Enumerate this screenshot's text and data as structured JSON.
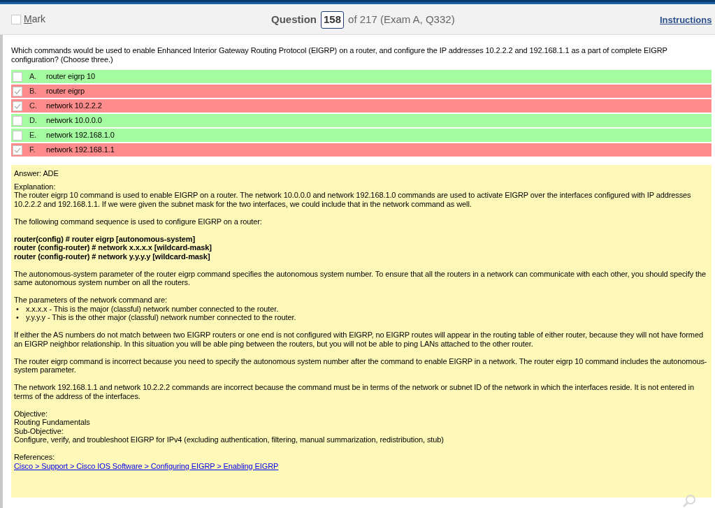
{
  "header": {
    "mark": {
      "label": "Mark",
      "checked": false
    },
    "question_label": "Question",
    "question_number": "158",
    "question_of": "of 217 (Exam A, Q332)",
    "instructions": "Instructions"
  },
  "question": "Which commands would be used to enable Enhanced Interior Gateway Routing Protocol (EIGRP) on a router, and configure the IP addresses 10.2.2.2 and 192.168.1.1 as a part of complete EIGRP configuration? (Choose three.)",
  "options": [
    {
      "letter": "A.",
      "text": "router eigrp 10",
      "checked": false,
      "correct": true
    },
    {
      "letter": "B.",
      "text": "router eigrp",
      "checked": true,
      "correct": false
    },
    {
      "letter": "C.",
      "text": "network 10.2.2.2",
      "checked": true,
      "correct": false
    },
    {
      "letter": "D.",
      "text": "network 10.0.0.0",
      "checked": false,
      "correct": true
    },
    {
      "letter": "E.",
      "text": "network 192.168.1.0",
      "checked": false,
      "correct": true
    },
    {
      "letter": "F.",
      "text": "network 192.168.1.1",
      "checked": true,
      "correct": false
    }
  ],
  "answer": "Answer: ADE",
  "explanation": [
    {
      "kind": "lines",
      "lines": [
        "Explanation:",
        "The router eigrp 10 command is used to enable EIGRP on a router. The network 10.0.0.0 and network 192.168.1.0 commands are used to activate EIGRP over the interfaces configured with IP addresses 10.2.2.2 and 192.168.1.1. If we were given the subnet mask for the two interfaces, we could include that in the network command as well."
      ]
    },
    {
      "kind": "lines",
      "lines": [
        "The following command sequence is used to configure EIGRP on a router:"
      ]
    },
    {
      "kind": "code",
      "lines": [
        "router(config) # router eigrp [autonomous-system]",
        "router (config-router) # network x.x.x.x [wildcard-mask]",
        "router (config-router) # network y.y.y.y [wildcard-mask]"
      ]
    },
    {
      "kind": "lines",
      "lines": [
        "The autonomous-system parameter of the router eigrp command specifies the autonomous system number. To ensure that all the routers in a network can communicate with each other, you should specify the same autonomous system number on all the routers."
      ]
    },
    {
      "kind": "bullets",
      "intro": "The parameters of the network command are:",
      "bullet": "•",
      "items": [
        "x.x.x.x - This is the major (classful) network number connected to the router.",
        "y.y.y.y - This is the other major (classful) network number connected to the router."
      ]
    },
    {
      "kind": "lines",
      "lines": [
        "If either the AS numbers do not match between two EIGRP routers or one end is not configured with EIGRP, no EIGRP routes will appear in the routing table of either router, because they will not have formed an EIGRP neighbor relationship. In this situation you will be able ping between the routers, but you will not be able to ping LANs attached to the other router."
      ]
    },
    {
      "kind": "lines",
      "lines": [
        "The router eigrp command is incorrect because you need to specify the autonomous system number after the command to enable EIGRP in a network. The router eigrp 10 command includes the autonomous-system parameter."
      ]
    },
    {
      "kind": "lines",
      "lines": [
        "The network 192.168.1.1 and network 10.2.2.2 commands are incorrect because the command must be in terms of the network or subnet ID of the network in which the interfaces reside. It is not entered in terms of the address of the interfaces."
      ]
    },
    {
      "kind": "lines",
      "lines": [
        "Objective:",
        "Routing Fundamentals",
        "Sub-Objective:",
        "Configure, verify, and troubleshoot EIGRP for IPv4 (excluding authentication, filtering, manual summarization, redistribution, stub)"
      ]
    },
    {
      "kind": "link",
      "label": "References:",
      "link": "Cisco > Support > Cisco IOS Software > Configuring EIGRP > Enabling EIGRP"
    }
  ]
}
